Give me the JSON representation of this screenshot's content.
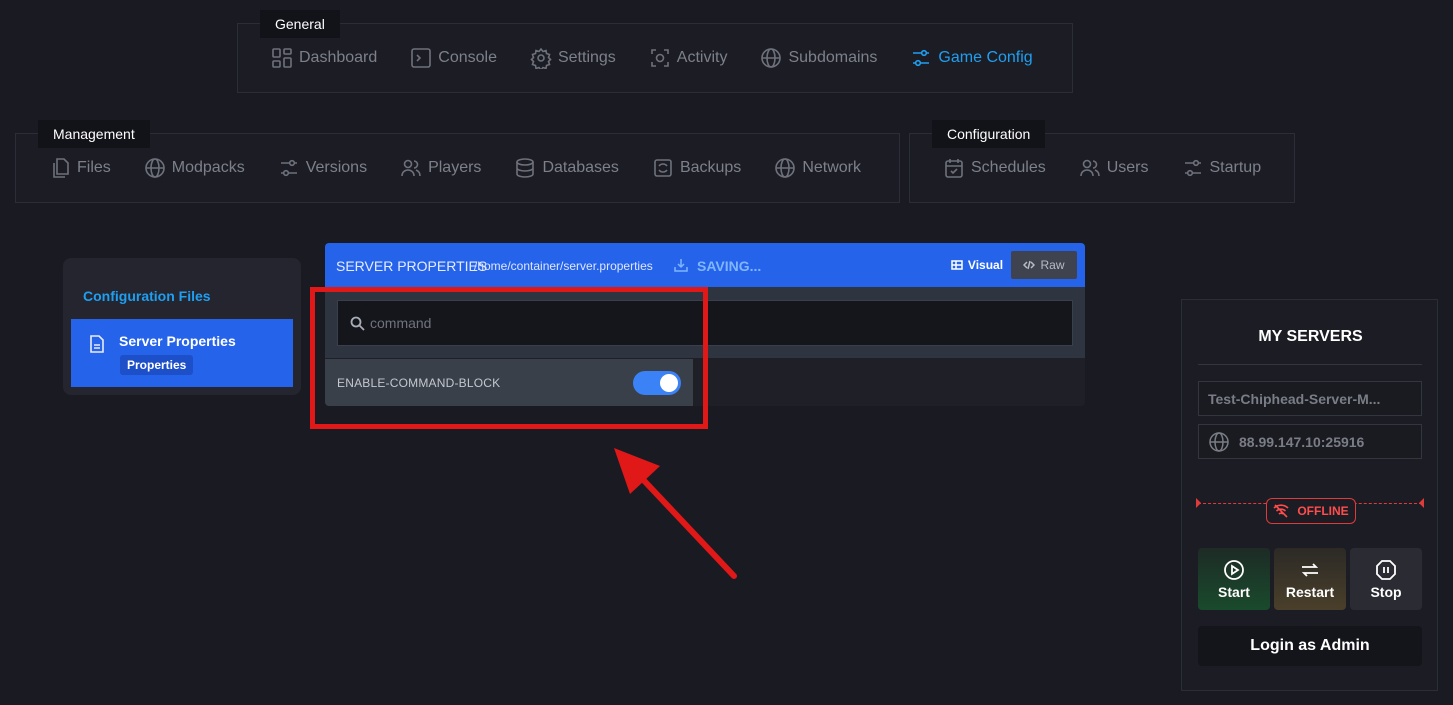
{
  "nav": {
    "general": {
      "title": "General",
      "items": [
        {
          "label": "Dashboard",
          "icon": "dashboard-icon"
        },
        {
          "label": "Console",
          "icon": "console-icon"
        },
        {
          "label": "Settings",
          "icon": "gear-icon"
        },
        {
          "label": "Activity",
          "icon": "activity-icon"
        },
        {
          "label": "Subdomains",
          "icon": "globe-icon"
        },
        {
          "label": "Game Config",
          "icon": "sliders-icon",
          "active": true
        }
      ]
    },
    "management": {
      "title": "Management",
      "items": [
        {
          "label": "Files",
          "icon": "files-icon"
        },
        {
          "label": "Modpacks",
          "icon": "globe-icon"
        },
        {
          "label": "Versions",
          "icon": "sliders-icon"
        },
        {
          "label": "Players",
          "icon": "users-icon"
        },
        {
          "label": "Databases",
          "icon": "database-icon"
        },
        {
          "label": "Backups",
          "icon": "backup-icon"
        },
        {
          "label": "Network",
          "icon": "globe-icon"
        }
      ]
    },
    "configuration": {
      "title": "Configuration",
      "items": [
        {
          "label": "Schedules",
          "icon": "calendar-icon"
        },
        {
          "label": "Users",
          "icon": "users-icon"
        },
        {
          "label": "Startup",
          "icon": "sliders-icon"
        }
      ]
    }
  },
  "config_files": {
    "title": "Configuration Files",
    "item": {
      "name": "Server Properties",
      "badge": "Properties"
    }
  },
  "editor": {
    "title": "SERVER PROPERTIES",
    "path": "/home/container/server.properties",
    "status": "SAVING...",
    "visual_label": "Visual",
    "raw_label": "Raw",
    "search": {
      "placeholder": "command",
      "value": ""
    },
    "property": {
      "key": "ENABLE-COMMAND-BLOCK",
      "enabled": true
    }
  },
  "servers": {
    "title": "MY SERVERS",
    "name": "Test-Chiphead-Server-M...",
    "address": "88.99.147.10:25916",
    "status": "OFFLINE",
    "start_label": "Start",
    "restart_label": "Restart",
    "stop_label": "Stop",
    "admin_label": "Login as Admin"
  },
  "colors": {
    "accent": "#2563eb",
    "active_nav": "#1e9ff2",
    "offline": "#e03a3a",
    "annotation": "#e01818"
  }
}
